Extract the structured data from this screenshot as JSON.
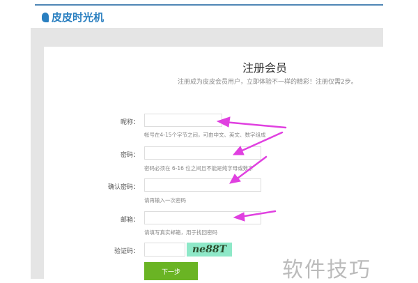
{
  "logo": {
    "text": "皮皮时光机"
  },
  "page": {
    "title": "注册会员",
    "subtitle": "注册成为皮皮会员用户，立即体验不一样的精彩！注册仅需2步。"
  },
  "form": {
    "nickname": {
      "label": "昵称：",
      "value": "",
      "hint": "帐号在4-15个字节之间，可由中文、英文、数字组成"
    },
    "password": {
      "label": "密码：",
      "value": "",
      "hint": "密码必须在 6-16 位之间且不能是纯字母或数字"
    },
    "confirm": {
      "label": "确认密码：",
      "value": "",
      "hint": "请再输入一次密码"
    },
    "email": {
      "label": "邮箱：",
      "value": "",
      "hint": "请填写真实邮箱，用于找回密码"
    },
    "captcha": {
      "label": "验证码：",
      "value": "",
      "image_text": "ne88T"
    },
    "next_label": "下一步"
  },
  "watermark": "软件技巧",
  "colors": {
    "accent": "#6ab424",
    "brand": "#2a7fc0",
    "arrow": "#e040e0"
  }
}
